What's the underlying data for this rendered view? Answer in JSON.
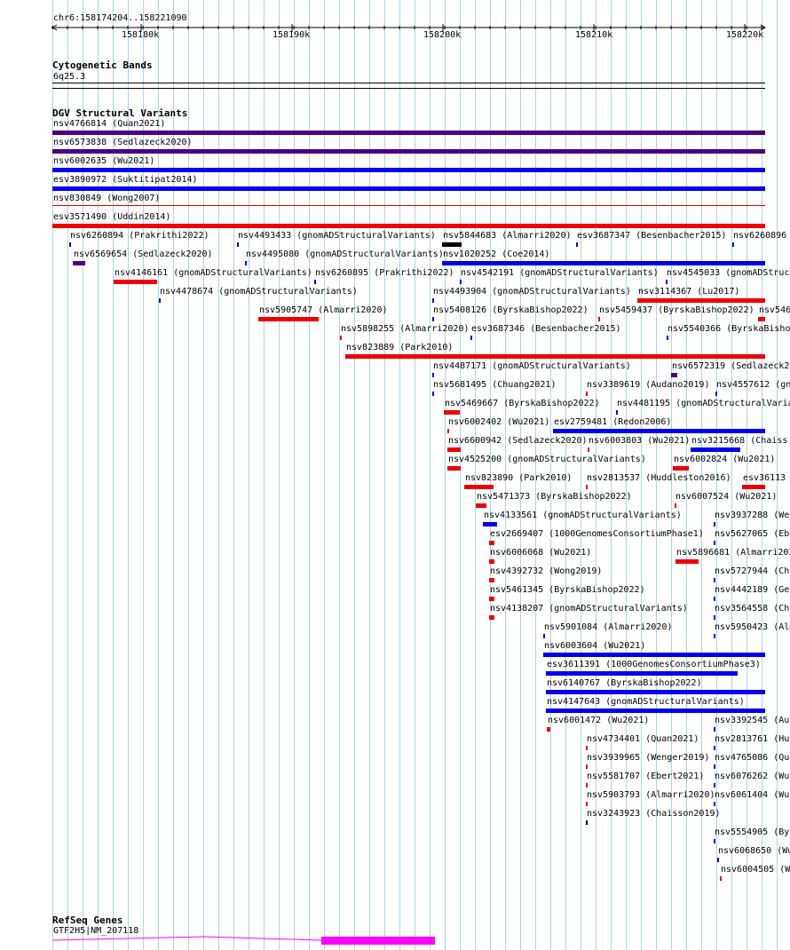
{
  "ruler": {
    "location": "chr6:158174204..158221090",
    "ticks": [
      "158180k",
      "158190k",
      "158200k",
      "158210k",
      "158220k"
    ]
  },
  "tracks": {
    "cytoband": {
      "title": "Cytogenetic Bands",
      "label": "6q25.3"
    },
    "dgv": {
      "title": "DGV Structural Variants"
    },
    "refseq": {
      "title": "RefSeq Genes",
      "label": "GTF2H5|NM_207118"
    }
  },
  "colors": {
    "gain": "#0000ee",
    "loss": "#ee0000",
    "gain_loss": "#4b0082",
    "complex": "#000000",
    "grid": "#a8d4e6",
    "gene": "#ff00ff"
  },
  "features": [
    {
      "label": "nsv4766814 (Quan2021)",
      "type": "gain_loss"
    },
    {
      "label": "nsv6573838 (Sedlazeck2020)",
      "type": "gain_loss"
    },
    {
      "label": "nsv6002635 (Wu2021)",
      "type": "gain"
    },
    {
      "label": "esv3890972 (Suktitipat2014)",
      "type": "gain"
    },
    {
      "label": "nsv830849 (Wong2007)",
      "type": "loss"
    },
    {
      "label": "esv3571490 (Uddin2014)",
      "type": "loss"
    },
    {
      "label": "nsv6260894 (Prakrithi2022)",
      "type": "gain"
    },
    {
      "label": "nsv4493433 (gnomADStructuralVariants)",
      "type": "gain"
    },
    {
      "label": "nsv5844683 (Almarri2020)",
      "type": "complex"
    },
    {
      "label": "esv3687347 (Besenbacher2015)",
      "type": "gain"
    },
    {
      "label": "nsv6260896",
      "type": "gain"
    },
    {
      "label": "nsv6569654 (Sedlazeck2020)",
      "type": "gain_loss"
    },
    {
      "label": "nsv4495080 (gnomADStructuralVariants)",
      "type": "gain"
    },
    {
      "label": "nsv1020252 (Coe2014)",
      "type": "gain"
    },
    {
      "label": "nsv4146161 (gnomADStructuralVariants)",
      "type": "loss"
    },
    {
      "label": "nsv6260895 (Prakrithi2022)",
      "type": "gain"
    },
    {
      "label": "nsv4542191 (gnomADStructuralVariants)",
      "type": "gain"
    },
    {
      "label": "nsv4545033 (gnomADStructu",
      "type": "gain"
    },
    {
      "label": "nsv4478674 (gnomADStructuralVariants)",
      "type": "gain"
    },
    {
      "label": "nsv4493904 (gnomADStructuralVariants)",
      "type": "gain"
    },
    {
      "label": "nsv3114367 (Lu2017)",
      "type": "loss"
    },
    {
      "label": "nsv5905747 (Almarri2020)",
      "type": "loss"
    },
    {
      "label": "nsv5408126 (ByrskaBishop2022)",
      "type": "gain"
    },
    {
      "label": "nsv5459437 (ByrskaBishop2022)",
      "type": "loss"
    },
    {
      "label": "nsv546",
      "type": "loss"
    },
    {
      "label": "nsv5898255 (Almarri2020)",
      "type": "loss"
    },
    {
      "label": "esv3687346 (Besenbacher2015)",
      "type": "gain"
    },
    {
      "label": "nsv5540366 (ByrskaBisho",
      "type": "gain"
    },
    {
      "label": "nsv823889 (Park2010)",
      "type": "loss"
    },
    {
      "label": "nsv4487171 (gnomADStructuralVariants)",
      "type": "gain"
    },
    {
      "label": "nsv6572319 (Sedlazeck20",
      "type": "gain_loss"
    },
    {
      "label": "nsv5681495 (Chuang2021)",
      "type": "gain"
    },
    {
      "label": "nsv3389619 (Audano2019)",
      "type": "loss"
    },
    {
      "label": "nsv4557612 (gno",
      "type": "gain"
    },
    {
      "label": "nsv5469667 (ByrskaBishop2022)",
      "type": "loss"
    },
    {
      "label": "nsv4481195 (gnomADStructuralVaria",
      "type": "gain"
    },
    {
      "label": "nsv6002402 (Wu2021)",
      "type": "loss"
    },
    {
      "label": "esv2759481 (Redon2006)",
      "type": "gain"
    },
    {
      "label": "nsv6600942 (Sedlazeck2020)",
      "type": "loss"
    },
    {
      "label": "nsv6003803 (Wu2021)",
      "type": "loss"
    },
    {
      "label": "nsv3215668 (Chaiss",
      "type": "gain"
    },
    {
      "label": "nsv4525200 (gnomADStructuralVariants)",
      "type": "loss"
    },
    {
      "label": "nsv6002824 (Wu2021)",
      "type": "loss"
    },
    {
      "label": "nsv823890 (Park2010)",
      "type": "loss"
    },
    {
      "label": "nsv2813537 (Huddleston2016)",
      "type": "loss"
    },
    {
      "label": "esv36113",
      "type": "loss"
    },
    {
      "label": "nsv5471373 (ByrskaBishop2022)",
      "type": "loss"
    },
    {
      "label": "nsv6007524 (Wu2021)",
      "type": "loss"
    },
    {
      "label": "nsv4133561 (gnomADStructuralVariants)",
      "type": "gain"
    },
    {
      "label": "nsv3937288 (Wen",
      "type": "gain"
    },
    {
      "label": "esv2669407 (1000GenomesConsortiumPhase1)",
      "type": "loss"
    },
    {
      "label": "nsv5627065 (Ebe",
      "type": "gain"
    },
    {
      "label": "nsv6006068 (Wu2021)",
      "type": "loss"
    },
    {
      "label": "nsv5896681 (Almarri202",
      "type": "loss"
    },
    {
      "label": "nsv4392732 (Wong2019)",
      "type": "loss"
    },
    {
      "label": "nsv5727944 (Chu",
      "type": "gain"
    },
    {
      "label": "nsv5461345 (ByrskaBishop2022)",
      "type": "loss"
    },
    {
      "label": "nsv4442189 (Gen",
      "type": "gain"
    },
    {
      "label": "nsv4138207 (gnomADStructuralVariants)",
      "type": "loss"
    },
    {
      "label": "nsv3564558 (Cha",
      "type": "gain"
    },
    {
      "label": "nsv5901084 (Almarri2020)",
      "type": "gain"
    },
    {
      "label": "nsv5950423 (Alm",
      "type": "gain"
    },
    {
      "label": "nsv6003604 (Wu2021)",
      "type": "gain"
    },
    {
      "label": "esv3611391 (1000GenomesConsortiumPhase3)",
      "type": "gain"
    },
    {
      "label": "nsv6140767 (ByrskaBishop2022)",
      "type": "gain"
    },
    {
      "label": "nsv4147643 (gnomADStructuralVariants)",
      "type": "gain"
    },
    {
      "label": "nsv6001472 (Wu2021)",
      "type": "loss"
    },
    {
      "label": "nsv3392545 (Auc",
      "type": "gain"
    },
    {
      "label": "nsv4734401 (Quan2021)",
      "type": "loss"
    },
    {
      "label": "nsv2813761 (Huc",
      "type": "gain"
    },
    {
      "label": "nsv3939965 (Wenger2019)",
      "type": "loss"
    },
    {
      "label": "nsv4765086 (Qua",
      "type": "gain"
    },
    {
      "label": "nsv5581707 (Ebert2021)",
      "type": "loss"
    },
    {
      "label": "nsv6076262 (Wu2",
      "type": "gain"
    },
    {
      "label": "nsv5903793 (Almarri2020)",
      "type": "loss"
    },
    {
      "label": "nsv6061404 (Wu",
      "type": "gain"
    },
    {
      "label": "nsv3243923 (Chaisson2019)",
      "type": "complex"
    },
    {
      "label": "nsv5554905 (Byr",
      "type": "gain"
    },
    {
      "label": "nsv6068650 (Wu",
      "type": "gain"
    },
    {
      "label": "nsv6004505 (Wu",
      "type": "loss"
    }
  ]
}
